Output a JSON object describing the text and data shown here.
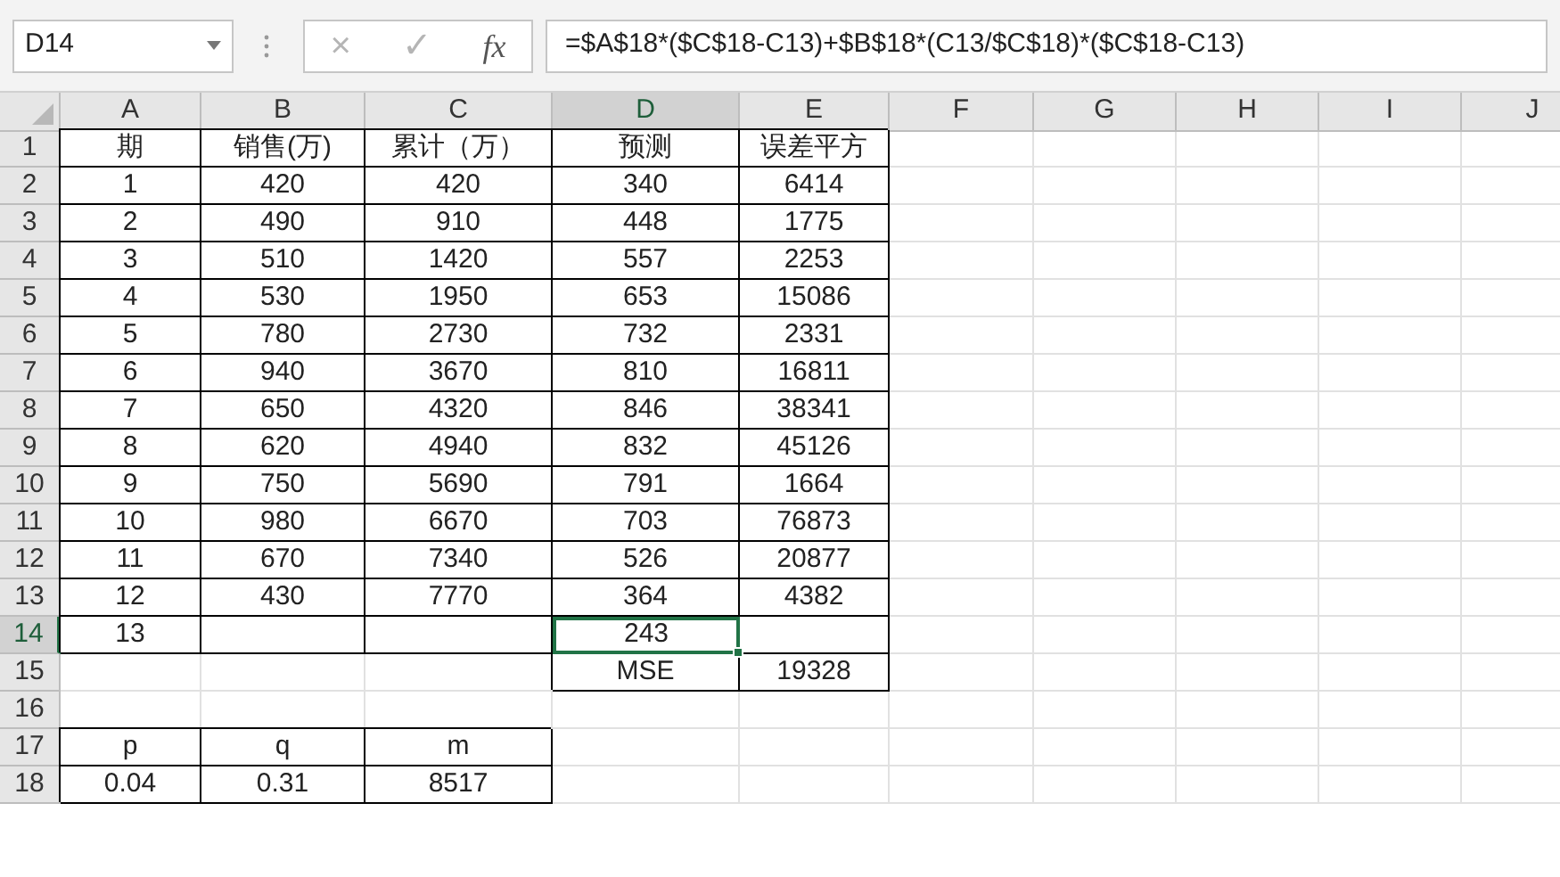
{
  "name_box": "D14",
  "formula_buttons": {
    "cancel": "×",
    "enter": "✓",
    "function": "fx"
  },
  "formula": "=$A$18*($C$18-C13)+$B$18*(C13/$C$18)*($C$18-C13)",
  "columns": [
    {
      "label": "A",
      "selected": false
    },
    {
      "label": "B",
      "selected": false
    },
    {
      "label": "C",
      "selected": false
    },
    {
      "label": "D",
      "selected": true
    },
    {
      "label": "E",
      "selected": false
    },
    {
      "label": "F",
      "selected": false
    },
    {
      "label": "G",
      "selected": false
    },
    {
      "label": "H",
      "selected": false
    },
    {
      "label": "I",
      "selected": false
    },
    {
      "label": "J",
      "selected": false
    }
  ],
  "rows": [
    {
      "number": "1",
      "selected": false,
      "cells": [
        {
          "text": "期",
          "bordered": true,
          "selected": false
        },
        {
          "text": "销售(万)",
          "bordered": true,
          "selected": false
        },
        {
          "text": "累计（万）",
          "bordered": true,
          "selected": false
        },
        {
          "text": "预测",
          "bordered": true,
          "selected": false
        },
        {
          "text": "误差平方",
          "bordered": true,
          "selected": false
        }
      ]
    },
    {
      "number": "2",
      "selected": false,
      "cells": [
        {
          "text": "1",
          "bordered": true,
          "selected": false
        },
        {
          "text": "420",
          "bordered": true,
          "selected": false
        },
        {
          "text": "420",
          "bordered": true,
          "selected": false
        },
        {
          "text": "340",
          "bordered": true,
          "selected": false
        },
        {
          "text": "6414",
          "bordered": true,
          "selected": false
        }
      ]
    },
    {
      "number": "3",
      "selected": false,
      "cells": [
        {
          "text": "2",
          "bordered": true,
          "selected": false
        },
        {
          "text": "490",
          "bordered": true,
          "selected": false
        },
        {
          "text": "910",
          "bordered": true,
          "selected": false
        },
        {
          "text": "448",
          "bordered": true,
          "selected": false
        },
        {
          "text": "1775",
          "bordered": true,
          "selected": false
        }
      ]
    },
    {
      "number": "4",
      "selected": false,
      "cells": [
        {
          "text": "3",
          "bordered": true,
          "selected": false
        },
        {
          "text": "510",
          "bordered": true,
          "selected": false
        },
        {
          "text": "1420",
          "bordered": true,
          "selected": false
        },
        {
          "text": "557",
          "bordered": true,
          "selected": false
        },
        {
          "text": "2253",
          "bordered": true,
          "selected": false
        }
      ]
    },
    {
      "number": "5",
      "selected": false,
      "cells": [
        {
          "text": "4",
          "bordered": true,
          "selected": false
        },
        {
          "text": "530",
          "bordered": true,
          "selected": false
        },
        {
          "text": "1950",
          "bordered": true,
          "selected": false
        },
        {
          "text": "653",
          "bordered": true,
          "selected": false
        },
        {
          "text": "15086",
          "bordered": true,
          "selected": false
        }
      ]
    },
    {
      "number": "6",
      "selected": false,
      "cells": [
        {
          "text": "5",
          "bordered": true,
          "selected": false
        },
        {
          "text": "780",
          "bordered": true,
          "selected": false
        },
        {
          "text": "2730",
          "bordered": true,
          "selected": false
        },
        {
          "text": "732",
          "bordered": true,
          "selected": false
        },
        {
          "text": "2331",
          "bordered": true,
          "selected": false
        }
      ]
    },
    {
      "number": "7",
      "selected": false,
      "cells": [
        {
          "text": "6",
          "bordered": true,
          "selected": false
        },
        {
          "text": "940",
          "bordered": true,
          "selected": false
        },
        {
          "text": "3670",
          "bordered": true,
          "selected": false
        },
        {
          "text": "810",
          "bordered": true,
          "selected": false
        },
        {
          "text": "16811",
          "bordered": true,
          "selected": false
        }
      ]
    },
    {
      "number": "8",
      "selected": false,
      "cells": [
        {
          "text": "7",
          "bordered": true,
          "selected": false
        },
        {
          "text": "650",
          "bordered": true,
          "selected": false
        },
        {
          "text": "4320",
          "bordered": true,
          "selected": false
        },
        {
          "text": "846",
          "bordered": true,
          "selected": false
        },
        {
          "text": "38341",
          "bordered": true,
          "selected": false
        }
      ]
    },
    {
      "number": "9",
      "selected": false,
      "cells": [
        {
          "text": "8",
          "bordered": true,
          "selected": false
        },
        {
          "text": "620",
          "bordered": true,
          "selected": false
        },
        {
          "text": "4940",
          "bordered": true,
          "selected": false
        },
        {
          "text": "832",
          "bordered": true,
          "selected": false
        },
        {
          "text": "45126",
          "bordered": true,
          "selected": false
        }
      ]
    },
    {
      "number": "10",
      "selected": false,
      "cells": [
        {
          "text": "9",
          "bordered": true,
          "selected": false
        },
        {
          "text": "750",
          "bordered": true,
          "selected": false
        },
        {
          "text": "5690",
          "bordered": true,
          "selected": false
        },
        {
          "text": "791",
          "bordered": true,
          "selected": false
        },
        {
          "text": "1664",
          "bordered": true,
          "selected": false
        }
      ]
    },
    {
      "number": "11",
      "selected": false,
      "cells": [
        {
          "text": "10",
          "bordered": true,
          "selected": false
        },
        {
          "text": "980",
          "bordered": true,
          "selected": false
        },
        {
          "text": "6670",
          "bordered": true,
          "selected": false
        },
        {
          "text": "703",
          "bordered": true,
          "selected": false
        },
        {
          "text": "76873",
          "bordered": true,
          "selected": false
        }
      ]
    },
    {
      "number": "12",
      "selected": false,
      "cells": [
        {
          "text": "11",
          "bordered": true,
          "selected": false
        },
        {
          "text": "670",
          "bordered": true,
          "selected": false
        },
        {
          "text": "7340",
          "bordered": true,
          "selected": false
        },
        {
          "text": "526",
          "bordered": true,
          "selected": false
        },
        {
          "text": "20877",
          "bordered": true,
          "selected": false
        }
      ]
    },
    {
      "number": "13",
      "selected": false,
      "cells": [
        {
          "text": "12",
          "bordered": true,
          "selected": false
        },
        {
          "text": "430",
          "bordered": true,
          "selected": false
        },
        {
          "text": "7770",
          "bordered": true,
          "selected": false
        },
        {
          "text": "364",
          "bordered": true,
          "selected": false
        },
        {
          "text": "4382",
          "bordered": true,
          "selected": false
        }
      ]
    },
    {
      "number": "14",
      "selected": true,
      "cells": [
        {
          "text": "13",
          "bordered": true,
          "selected": false
        },
        {
          "bordered": true,
          "selected": false
        },
        {
          "bordered": true,
          "selected": false
        },
        {
          "text": "243",
          "bordered": true,
          "selected": true
        },
        {
          "bordered": true,
          "selected": false
        }
      ]
    },
    {
      "number": "15",
      "selected": false,
      "cells": [
        {
          "bordered": false,
          "selected": false
        },
        {
          "bordered": false,
          "selected": false
        },
        {
          "bordered": false,
          "selected": false
        },
        {
          "text": "MSE",
          "bordered": true,
          "selected": false
        },
        {
          "text": "19328",
          "bordered": true,
          "selected": false
        }
      ]
    },
    {
      "number": "16",
      "selected": false,
      "cells": []
    },
    {
      "number": "17",
      "selected": false,
      "cells": [
        {
          "text": "p",
          "bordered": true,
          "selected": false
        },
        {
          "text": "q",
          "bordered": true,
          "selected": false
        },
        {
          "text": "m",
          "bordered": true,
          "selected": false
        }
      ]
    },
    {
      "number": "18",
      "selected": false,
      "cells": [
        {
          "text": "0.04",
          "bordered": true,
          "selected": false
        },
        {
          "text": "0.31",
          "bordered": true,
          "selected": false
        },
        {
          "text": "8517",
          "bordered": true,
          "selected": false
        }
      ]
    }
  ]
}
